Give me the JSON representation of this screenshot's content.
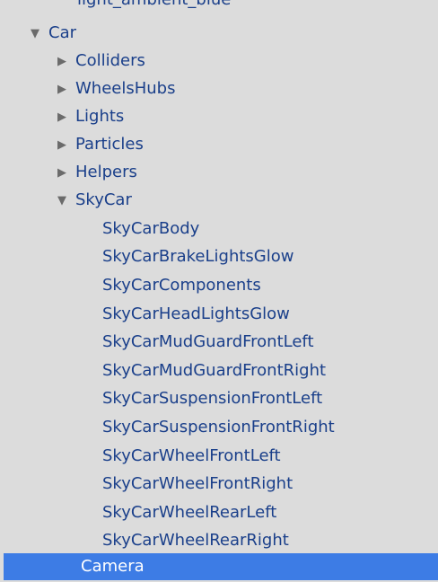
{
  "hierarchy": {
    "partial_item": "light_ambient_blue",
    "items": [
      {
        "label": "Car",
        "expanded": true
      },
      {
        "label": "Colliders",
        "expanded": false
      },
      {
        "label": "WheelsHubs",
        "expanded": false
      },
      {
        "label": "Lights",
        "expanded": false
      },
      {
        "label": "Particles",
        "expanded": false
      },
      {
        "label": "Helpers",
        "expanded": false
      },
      {
        "label": "SkyCar",
        "expanded": true
      },
      {
        "label": "SkyCarBody"
      },
      {
        "label": "SkyCarBrakeLightsGlow"
      },
      {
        "label": "SkyCarComponents"
      },
      {
        "label": "SkyCarHeadLightsGlow"
      },
      {
        "label": "SkyCarMudGuardFrontLeft"
      },
      {
        "label": "SkyCarMudGuardFrontRight"
      },
      {
        "label": "SkyCarSuspensionFrontLeft"
      },
      {
        "label": "SkyCarSuspensionFrontRight"
      },
      {
        "label": "SkyCarWheelFrontLeft"
      },
      {
        "label": "SkyCarWheelFrontRight"
      },
      {
        "label": "SkyCarWheelRearLeft"
      },
      {
        "label": "SkyCarWheelRearRight"
      },
      {
        "label": "Camera",
        "selected": true
      }
    ]
  },
  "colors": {
    "background": "#dcdcdc",
    "text": "#1a3f8a",
    "selection": "#3d7ce5",
    "arrow": "#6b6b6b"
  },
  "icons": {
    "expanded": "triangle-down-icon",
    "collapsed": "triangle-right-icon"
  }
}
